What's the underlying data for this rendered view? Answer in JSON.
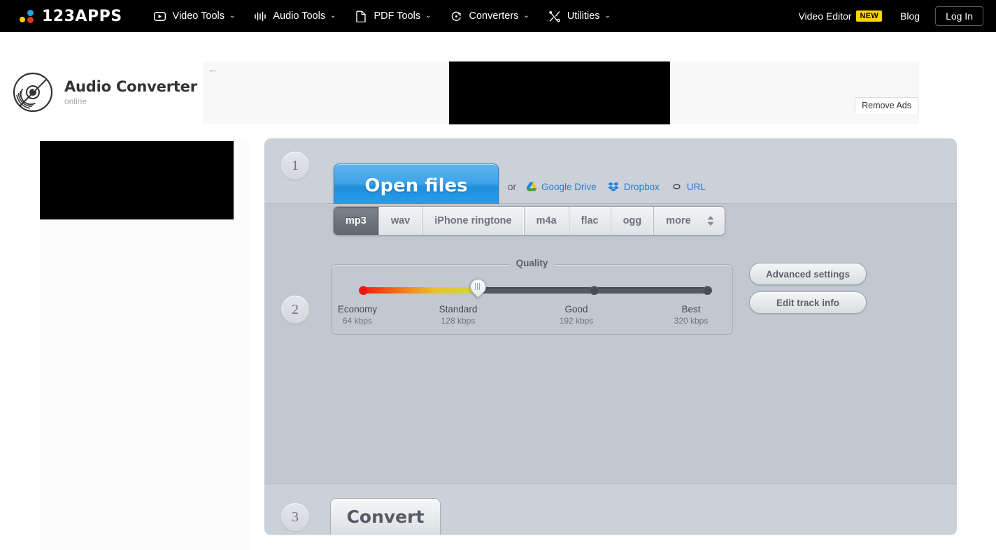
{
  "nav": {
    "logo_text": "123APPS",
    "items": [
      {
        "label": "Video Tools",
        "icon": "video-play-icon",
        "caret": "⌄"
      },
      {
        "label": "Audio Tools",
        "icon": "audio-waveform-icon",
        "caret": "⌄"
      },
      {
        "label": "PDF Tools",
        "icon": "document-page-icon",
        "caret": "⌄"
      },
      {
        "label": "Converters",
        "icon": "circular-arrow-icon",
        "caret": "⌄"
      },
      {
        "label": "Utilities",
        "icon": "crossed-tools-icon",
        "caret": "⌄"
      }
    ],
    "video_editor": "Video Editor",
    "new_badge": "NEW",
    "blog": "Blog",
    "login": "Log In"
  },
  "header": {
    "app_title": "Audio Converter",
    "app_subtitle": "online",
    "logo_icon": "vinyl-record-icon",
    "back_arrow": "←",
    "remove_ads": "Remove Ads"
  },
  "step1": {
    "number": "1",
    "open_files": "Open files",
    "or": "or",
    "sources": [
      {
        "label": "Google Drive",
        "icon": "google-drive-icon"
      },
      {
        "label": "Dropbox",
        "icon": "dropbox-icon"
      },
      {
        "label": "URL",
        "icon": "link-icon"
      }
    ]
  },
  "step2": {
    "number": "2",
    "formats": [
      {
        "label": "mp3",
        "active": true
      },
      {
        "label": "wav",
        "active": false
      },
      {
        "label": "iPhone ringtone",
        "active": false
      },
      {
        "label": "m4a",
        "active": false
      },
      {
        "label": "flac",
        "active": false
      },
      {
        "label": "ogg",
        "active": false
      },
      {
        "label": "more",
        "active": false
      }
    ],
    "quality": {
      "title": "Quality",
      "selected_index": 1,
      "steps": [
        {
          "name": "Economy",
          "bitrate": "64 kbps"
        },
        {
          "name": "Standard",
          "bitrate": "128 kbps"
        },
        {
          "name": "Good",
          "bitrate": "192 kbps"
        },
        {
          "name": "Best",
          "bitrate": "320 kbps"
        }
      ]
    },
    "advanced_settings": "Advanced settings",
    "edit_track_info": "Edit track info"
  },
  "step3": {
    "number": "3",
    "convert": "Convert"
  },
  "colors": {
    "nav_bg": "#000000",
    "accent_blue": "#2b7ccc",
    "open_files_blue": "#3da2e8",
    "badge_yellow": "#ffd400",
    "workspace_bg": "#c3cad2"
  }
}
